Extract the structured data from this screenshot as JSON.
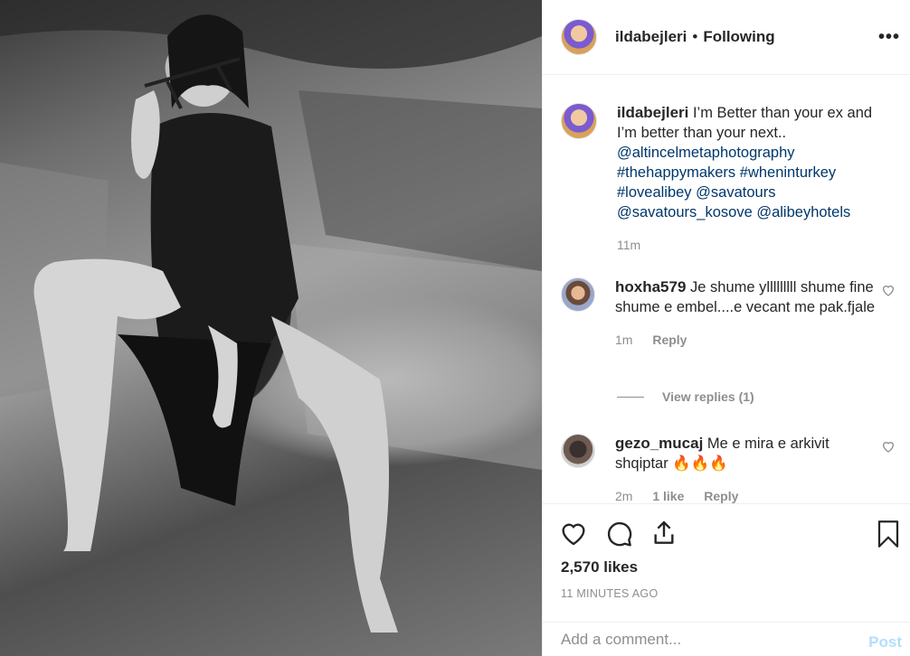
{
  "post": {
    "username": "ildabejleri",
    "separator": "•",
    "follow_status": "Following",
    "more_icon": "more-horizontal-icon"
  },
  "caption": {
    "username": "ildabejleri",
    "text": "I’m Better than your ex and I’m better than your next..",
    "links": [
      "@altincelmetaphotography",
      "#thehappymakers",
      "#wheninturkey",
      "#lovealibey",
      "@savatours",
      "@savatours_kosove",
      "@alibeyhotels"
    ],
    "time": "11m"
  },
  "comments": [
    {
      "username": "hoxha579",
      "text": "Je shume ylllllllll shume fine shume e embel....e vecant me pak.fjale",
      "time": "1m",
      "reply_label": "Reply",
      "view_replies": "View replies (1)"
    },
    {
      "username": "gezo_mucaj",
      "text": "Me e mira e arkivit shqiptar 🔥🔥🔥",
      "time": "2m",
      "likes": "1 like",
      "reply_label": "Reply"
    }
  ],
  "actions": {
    "likes": "2,570 likes",
    "time_ago": "11 MINUTES AGO"
  },
  "add_comment": {
    "placeholder": "Add a comment...",
    "post_label": "Post"
  },
  "colors": {
    "link": "#00376b",
    "muted": "#8e8e8e",
    "post_disabled": "#b2dffc"
  }
}
